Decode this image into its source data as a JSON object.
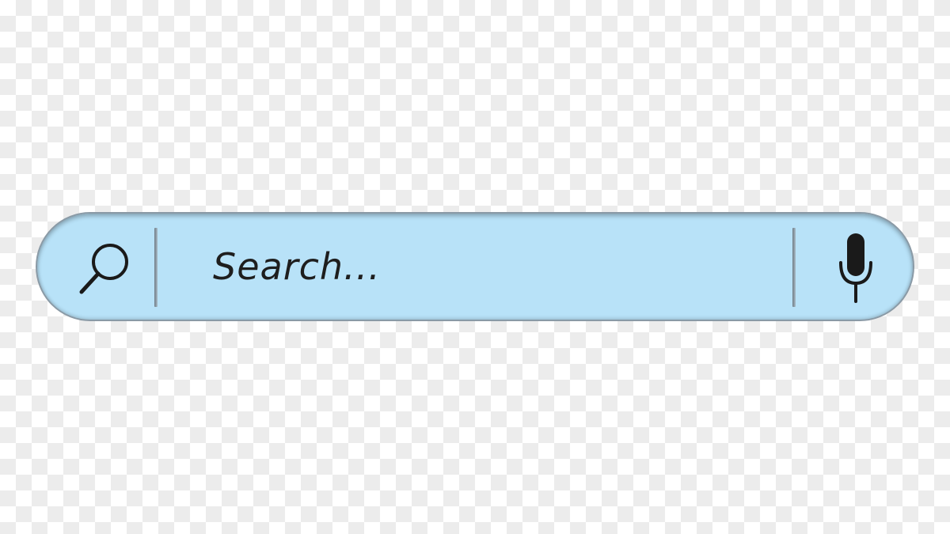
{
  "search": {
    "placeholder": "Search...",
    "value": ""
  },
  "icons": {
    "left": "search-icon",
    "right": "microphone-icon"
  },
  "colors": {
    "bar_fill": "#b8e2f8",
    "bar_border": "#8a9aa6",
    "icon": "#1a1a1a",
    "text": "#1e1e1e",
    "checker_light": "#ffffff",
    "checker_dark": "#ececec"
  }
}
